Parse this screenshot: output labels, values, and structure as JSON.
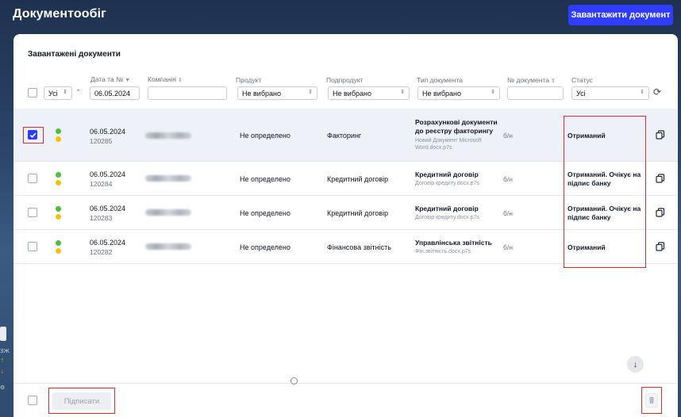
{
  "header": {
    "title": "Документообіг",
    "upload_label": "Завантажити документ"
  },
  "sidebar": {
    "labels": [
      "ЗЖ",
      "↑",
      "↓",
      "⚙"
    ]
  },
  "main": {
    "section_title": "Завантажені документи",
    "filters": {
      "all_label": "Усі",
      "date_label": "Дата та №",
      "date_value": "06.05.2024",
      "company_label": "Компанія",
      "company_value": "",
      "product_label": "Продукт",
      "product_value": "Не вибрано",
      "subproduct_label": "Подпродукт",
      "subproduct_value": "Не вибрано",
      "doctype_label": "Тип документа",
      "doctype_value": "Не вибрано",
      "docnum_label": "№ документа",
      "docnum_value": "",
      "status_label": "Статус",
      "status_value": "Усі"
    },
    "rows": [
      {
        "date": "06.05.2024",
        "number": "120285",
        "product": "Не определено",
        "subproduct": "Факторинг",
        "doc_title": "Розрахункові документи до реєстру факторингу",
        "doc_file": "Новий Документ Microsoft Word.docx.p7s",
        "doc_no": "б/н",
        "status": "Отриманий",
        "checked": true
      },
      {
        "date": "06.05.2024",
        "number": "120284",
        "product": "Не определено",
        "subproduct": "Кредитний договір",
        "doc_title": "Кредитний договір",
        "doc_file": "Договір кредиту.docx.p7s",
        "doc_no": "б/н",
        "status": "Отриманий. Очікує на підпис банку",
        "checked": false
      },
      {
        "date": "06.05.2024",
        "number": "120283",
        "product": "Не определено",
        "subproduct": "Кредитний договір",
        "doc_title": "Кредитний договір",
        "doc_file": "Договір кредиту.docx.p7s",
        "doc_no": "б/н",
        "status": "Отриманий. Очікує на підпис банку",
        "checked": false
      },
      {
        "date": "06.05.2024",
        "number": "120282",
        "product": "Не определено",
        "subproduct": "Фінансова звітність",
        "doc_title": "Управлінська звітність",
        "doc_file": "Фін.звітність.docx.p7s",
        "doc_no": "б/н",
        "status": "Отриманий",
        "checked": false
      }
    ]
  },
  "footer": {
    "sign_label": "Підписати"
  },
  "colors": {
    "accent": "#2f3cff",
    "status_green": "#4cc23a",
    "status_yellow": "#f4c20d",
    "highlight": "#e32b2b"
  },
  "icons": {
    "refresh": "refresh-icon",
    "copy": "copy-icon",
    "trash": "trash-icon",
    "down": "arrow-down-icon"
  }
}
